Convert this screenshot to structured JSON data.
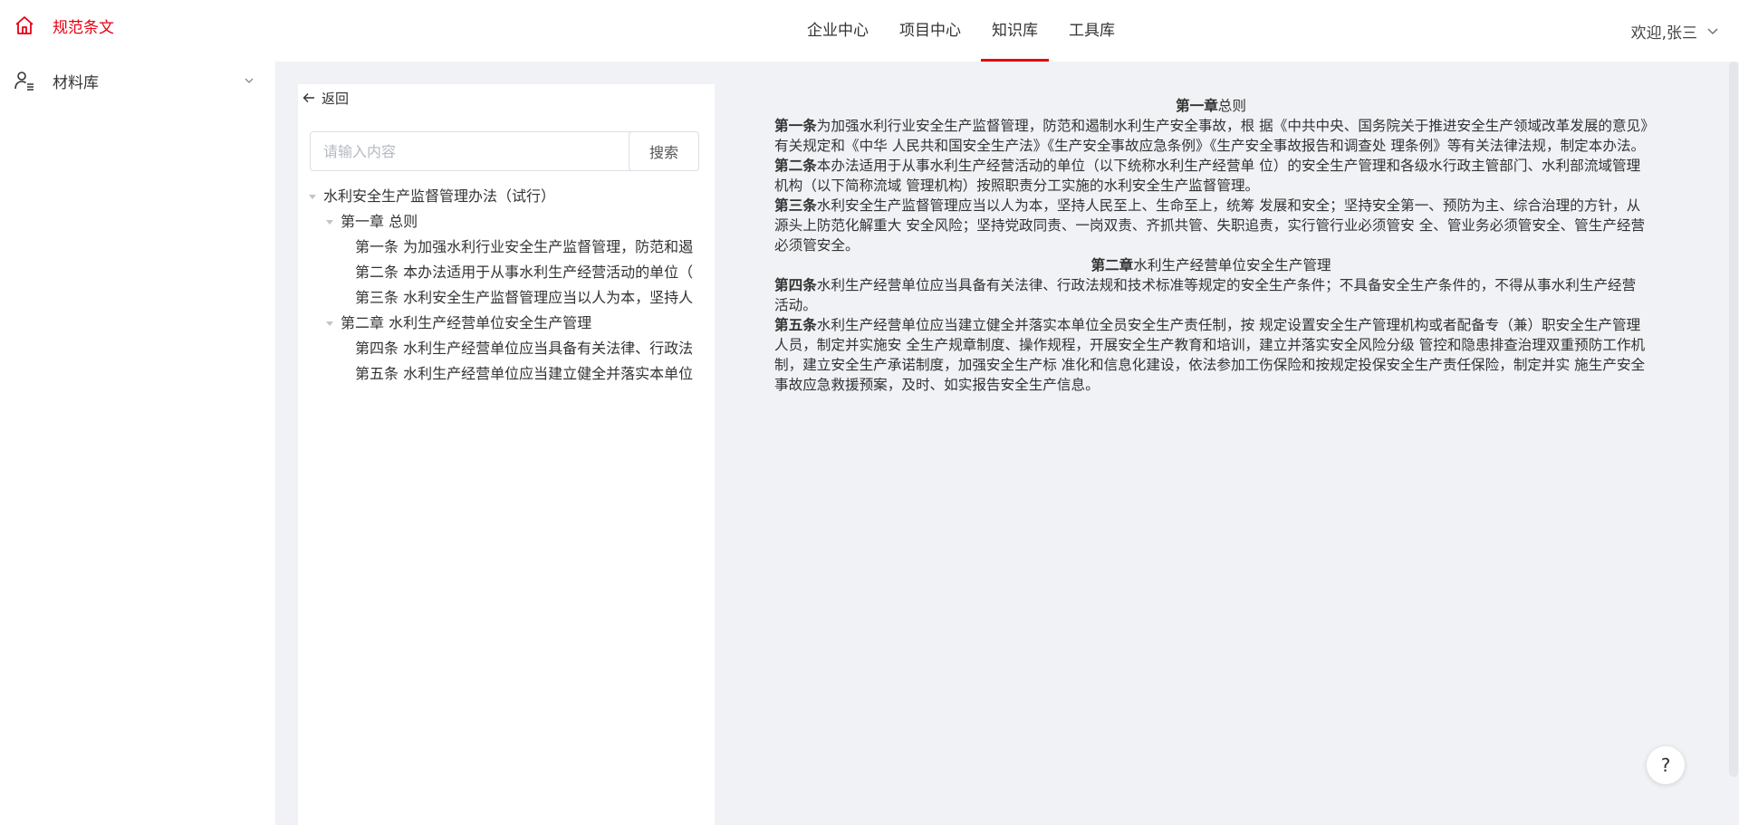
{
  "sidebar": {
    "items": [
      {
        "label": "规范条文",
        "icon": "home-icon",
        "active": true
      },
      {
        "label": "材料库",
        "icon": "user-list-icon",
        "active": false
      }
    ]
  },
  "header": {
    "nav": [
      {
        "label": "企业中心"
      },
      {
        "label": "项目中心"
      },
      {
        "label": "知识库",
        "active": true
      },
      {
        "label": "工具库"
      }
    ],
    "user": "欢迎,张三"
  },
  "tree_panel": {
    "back_label": "返回",
    "search_placeholder": "请输入内容",
    "search_button": "搜索",
    "nodes": [
      "水利安全生产监督管理办法（试行）",
      "第一章 总则",
      "第一条 为加强水利行业安全生产监督管理，防范和遏",
      "第二条 本办法适用于从事水利生产经营活动的单位（",
      "第三条 水利安全生产监督管理应当以人为本，坚持人",
      "第二章 水利生产经营单位安全生产管理",
      "第四条 水利生产经营单位应当具备有关法律、行政法",
      "第五条 水利生产经营单位应当建立健全并落实本单位"
    ]
  },
  "content": {
    "ch1_bold": "第一章",
    "ch1_rest": "总则",
    "a1_bold": "第一条",
    "a1_text": "为加强水利行业安全生产监督管理，防范和遏制水利生产安全事故，根 据《中共中央、国务院关于推进安全生产领域改革发展的意见》有关规定和《中华 人民共和国安全生产法》《生产安全事故应急条例》《生产安全事故报告和调查处 理条例》等有关法律法规，制定本办法。",
    "a2_bold": "第二条",
    "a2_text": "本办法适用于从事水利生产经营活动的单位（以下统称水利生产经营单 位）的安全生产管理和各级水行政主管部门、水利部流域管理机构（以下简称流域 管理机构）按照职责分工实施的水利安全生产监督管理。",
    "a3_bold": "第三条",
    "a3_text": "水利安全生产监督管理应当以人为本，坚持人民至上、生命至上，统筹 发展和安全；坚持安全第一、预防为主、综合治理的方针，从源头上防范化解重大 安全风险；坚持党政同责、一岗双责、齐抓共管、失职追责，实行管行业必须管安 全、管业务必须管安全、管生产经营必须管安全。",
    "ch2_bold": "第二章",
    "ch2_rest": "水利生产经营单位安全生产管理",
    "a4_bold": "第四条",
    "a4_text": "水利生产经营单位应当具备有关法律、行政法规和技术标准等规定的安全生产条件；不具备安全生产条件的，不得从事水利生产经营活动。",
    "a5_bold": "第五条",
    "a5_text": "水利生产经营单位应当建立健全并落实本单位全员安全生产责任制，按 规定设置安全生产管理机构或者配备专（兼）职安全生产管理人员，制定并实施安 全生产规章制度、操作规程，开展安全生产教育和培训，建立并落实安全风险分级 管控和隐患排查治理双重预防工作机制，建立安全生产承诺制度，加强安全生产标 准化和信息化建设，依法参加工伤保险和按规定投保安全生产责任保险，制定并实 施生产安全事故应急救援预案，及时、如实报告安全生产信息。"
  },
  "help_label": "?",
  "colors": {
    "accent": "#e60012",
    "background": "#f0f2f5"
  }
}
